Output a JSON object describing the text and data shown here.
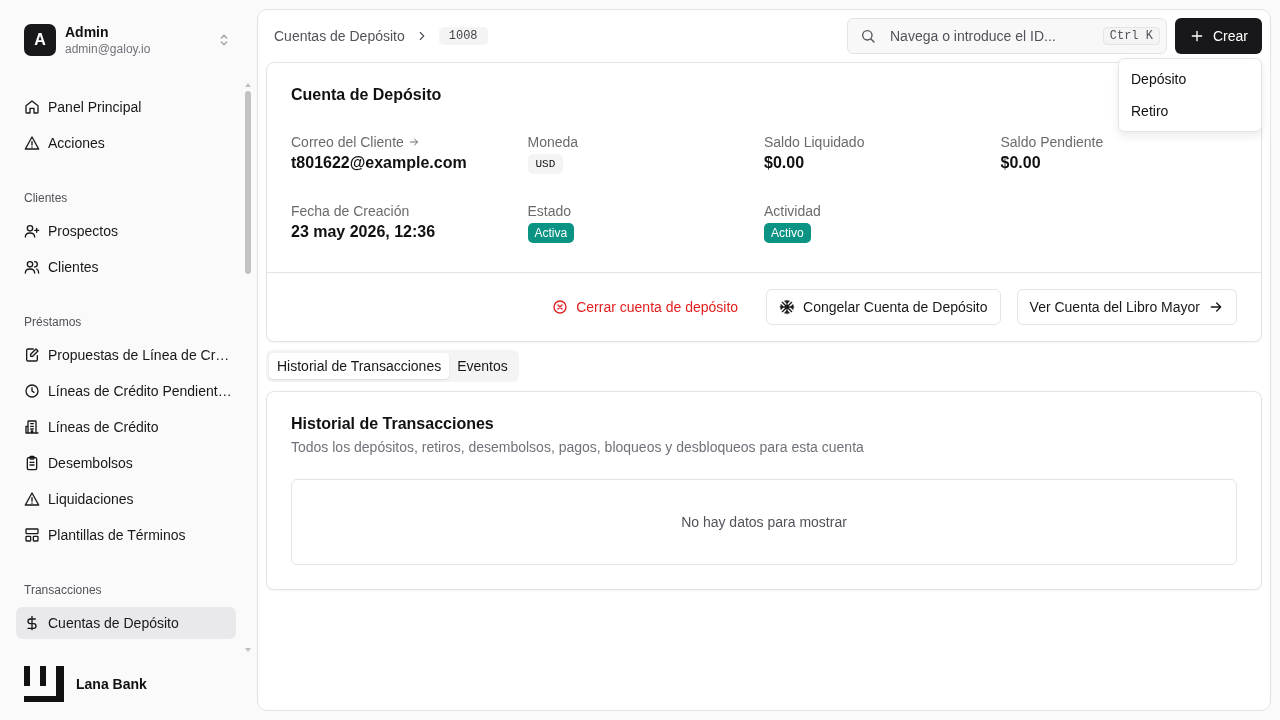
{
  "user": {
    "initial": "A",
    "name": "Admin",
    "email": "admin@galoy.io"
  },
  "sidebar": {
    "sections": [
      {
        "items": [
          {
            "label": "Panel Principal",
            "kind": "home",
            "selected": false
          },
          {
            "label": "Acciones",
            "kind": "warning",
            "selected": false
          }
        ]
      },
      {
        "heading": "Clientes",
        "items": [
          {
            "label": "Prospectos",
            "kind": "userplus",
            "selected": false
          },
          {
            "label": "Clientes",
            "kind": "users",
            "selected": false
          }
        ]
      },
      {
        "heading": "Préstamos",
        "items": [
          {
            "label": "Propuestas de Línea de Cr…",
            "kind": "edit",
            "selected": false
          },
          {
            "label": "Líneas de Crédito Pendient…",
            "kind": "clock",
            "selected": false
          },
          {
            "label": "Líneas de Crédito",
            "kind": "building",
            "selected": false
          },
          {
            "label": "Desembolsos",
            "kind": "clipboard",
            "selected": false
          },
          {
            "label": "Liquidaciones",
            "kind": "warning",
            "selected": false
          },
          {
            "label": "Plantillas de Términos",
            "kind": "layout",
            "selected": false
          }
        ]
      },
      {
        "heading": "Transacciones",
        "items": [
          {
            "label": "Cuentas de Depósito",
            "kind": "dollar",
            "selected": true
          }
        ]
      }
    ]
  },
  "brand": "Lana Bank",
  "breadcrumb": {
    "parent": "Cuentas de Depósito",
    "id": "1008"
  },
  "search": {
    "placeholder": "Navega o introduce el ID...",
    "shortcut": "Ctrl K"
  },
  "create_button": "Crear",
  "create_menu": [
    "Depósito",
    "Retiro"
  ],
  "account": {
    "title": "Cuenta de Depósito",
    "fields": [
      {
        "label": "Correo del Cliente",
        "value": "t801622@example.com",
        "kind": "text",
        "link": true
      },
      {
        "label": "Moneda",
        "value": "USD",
        "kind": "code",
        "link": false
      },
      {
        "label": "Saldo Liquidado",
        "value": "$0.00",
        "kind": "text",
        "link": false
      },
      {
        "label": "Saldo Pendiente",
        "value": "$0.00",
        "kind": "text",
        "link": false
      },
      {
        "label": "Fecha de Creación",
        "value": "23 may 2026, 12:36",
        "kind": "text",
        "link": false
      },
      {
        "label": "Estado",
        "value": "Activa",
        "kind": "badge",
        "link": false
      },
      {
        "label": "Actividad",
        "value": "Activo",
        "kind": "badge",
        "link": false
      }
    ],
    "actions": [
      {
        "kind": "danger",
        "label": "Cerrar cuenta de depósito"
      },
      {
        "kind": "freeze",
        "label": "Congelar Cuenta de Depósito"
      },
      {
        "kind": "ledger",
        "label": "Ver Cuenta del Libro Mayor"
      }
    ]
  },
  "tabs": [
    {
      "label": "Historial de Transacciones",
      "selected": true
    },
    {
      "label": "Eventos",
      "selected": false
    }
  ],
  "history": {
    "title": "Historial de Transacciones",
    "description": "Todos los depósitos, retiros, desembolsos, pagos, bloqueos y desbloqueos para esta cuenta",
    "empty": "No hay datos para mostrar"
  }
}
